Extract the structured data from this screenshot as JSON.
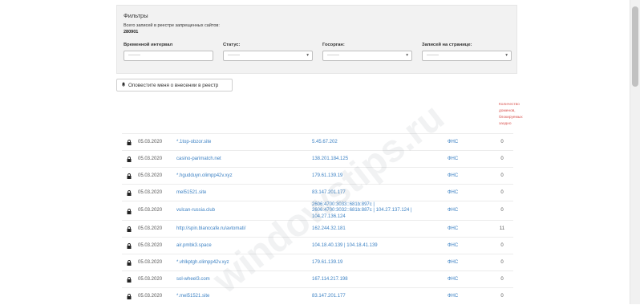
{
  "filters": {
    "title": "Фильтры",
    "total_label": "Всего записей в реестре запрещенных сайтов:",
    "total_value": "280901",
    "fields": [
      {
        "label": "Временной интервал",
        "placeholder": "———"
      },
      {
        "label": "Статус:",
        "placeholder": "———"
      },
      {
        "label": "Госорган:",
        "placeholder": "———"
      },
      {
        "label": "Записей на странице:",
        "placeholder": "———"
      }
    ]
  },
  "notify_button": {
    "label": "Оповестите меня о внесении в реестр",
    "icon": "bell-icon"
  },
  "table": {
    "count_header": "Количество доменов, блокируемых заодно",
    "rows": [
      {
        "date": "05.03.2020",
        "domain": "*.1top-obzor.site",
        "ip": [
          "5.45.67.202"
        ],
        "org": "ФНС",
        "count": "0"
      },
      {
        "date": "05.03.2020",
        "domain": "casino-parimatch.net",
        "ip": [
          "138.201.184.125"
        ],
        "org": "ФНС",
        "count": "0"
      },
      {
        "date": "05.03.2020",
        "domain": "*.hgudduyn.olimpp42v.xyz",
        "ip": [
          "179.61.139.19"
        ],
        "org": "ФНС",
        "count": "0"
      },
      {
        "date": "05.03.2020",
        "domain": "mel51521.site",
        "ip": [
          "83.147.201.177"
        ],
        "org": "ФНС",
        "count": "0"
      },
      {
        "date": "05.03.2020",
        "domain": "vulcan-russia.club",
        "ip": [
          "2606:4700:3033::681b:897c |",
          "2606:4700:3032::681b:887c | 104.27.137.124 |",
          "104.27.136.124"
        ],
        "org": "ФНС",
        "count": "0"
      },
      {
        "date": "05.03.2020",
        "domain": "http://spin.blanccafe.ru/avtomati/",
        "ip": [
          "162.244.32.181"
        ],
        "org": "ФНС",
        "count": "11"
      },
      {
        "date": "05.03.2020",
        "domain": "air.pmbk3.space",
        "ip": [
          "104.18.40.139 | 104.18.41.139"
        ],
        "org": "ФНС",
        "count": "0"
      },
      {
        "date": "05.03.2020",
        "domain": "*.vhlkptgh.olimpp42v.xyz",
        "ip": [
          "179.61.139.19"
        ],
        "org": "ФНС",
        "count": "0"
      },
      {
        "date": "05.03.2020",
        "domain": "sol-wheel3.com",
        "ip": [
          "167.114.217.198"
        ],
        "org": "ФНС",
        "count": "0"
      },
      {
        "date": "05.03.2020",
        "domain": "*.mel51521.site",
        "ip": [
          "83.147.201.177"
        ],
        "org": "ФНС",
        "count": "0"
      }
    ]
  },
  "watermark": "windowstips.ru",
  "colors": {
    "link": "#3d82c4",
    "note": "#d9534f",
    "panel": "#f2f2f2"
  }
}
